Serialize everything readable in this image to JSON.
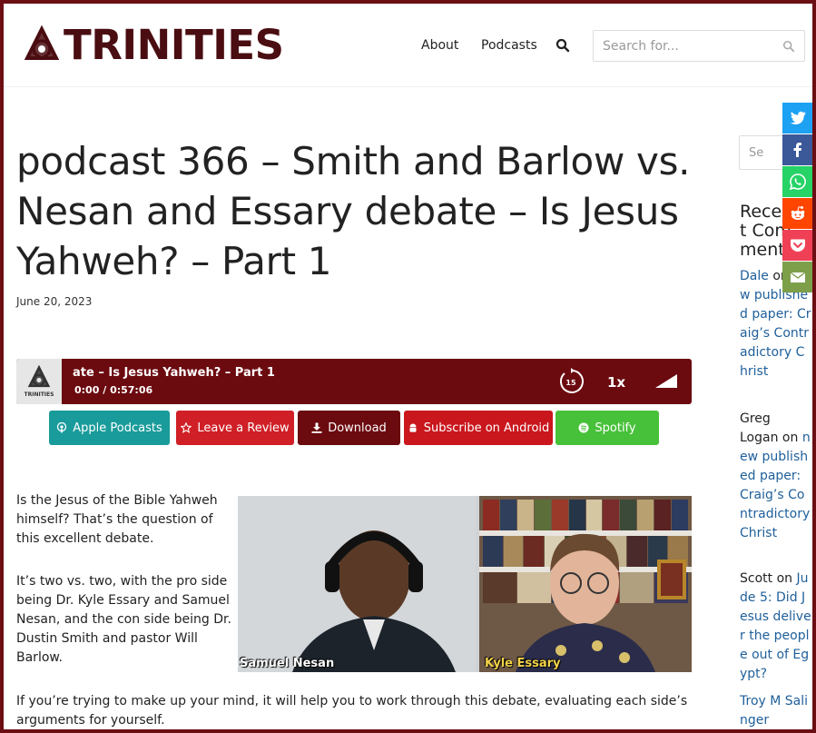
{
  "site": {
    "name": "TRINITIES",
    "brand_color": "#4a0d11"
  },
  "nav": {
    "about": "About",
    "podcasts": "Podcasts",
    "search_placeholder": "Search for..."
  },
  "post": {
    "title": "podcast 366 – Smith and Barlow vs. Nesan and Essary debate – Is Jesus Yahweh? – Part 1",
    "date": "June 20, 2023",
    "paragraphs": [
      "Is the Jesus of the Bible Yahweh himself? That’s the question of this excellent debate.",
      "It’s two vs. two, with the pro side being Dr. Kyle Essary and Samuel Nesan, and the con side being Dr. Dustin Smith and pastor Will Barlow.",
      "If you’re trying to make up your mind, it will help you to work through this debate, evaluating each side’s arguments for yourself."
    ],
    "image_captions": {
      "left": "Samuel Nesan",
      "right": "Kyle Essary"
    }
  },
  "player": {
    "thumb_label": "TRINITIES",
    "title": "ate – Is Jesus Yahweh? – Part 1",
    "current_time": "0:00",
    "duration": "/ 0:57:06",
    "rewind_seconds": "15",
    "speed": "1x",
    "color": "#6b0a0f"
  },
  "subscribe": {
    "apple": "Apple Podcasts",
    "review": "Leave a Review",
    "download": "Download",
    "android": "Subscribe on Android",
    "spotify": "Spotify"
  },
  "sidebar": {
    "search_placeholder": "Se",
    "heading": "Recent Comments",
    "comments": [
      {
        "author": "Dale",
        "on": "on",
        "post": "new published paper: Craig’s Contradictory Christ"
      },
      {
        "author": "Greg Logan",
        "on": "on",
        "post": "new published paper: Craig’s Contradictory Christ"
      },
      {
        "author": "Scott",
        "on": "on",
        "post": "Jude 5: Did Jesus deliver the people out of Egypt?"
      },
      {
        "author": "Troy M Salinger",
        "on": "",
        "post": ""
      }
    ]
  },
  "share": [
    "twitter-icon",
    "facebook-icon",
    "whatsapp-icon",
    "reddit-icon",
    "pocket-icon",
    "email-icon"
  ]
}
